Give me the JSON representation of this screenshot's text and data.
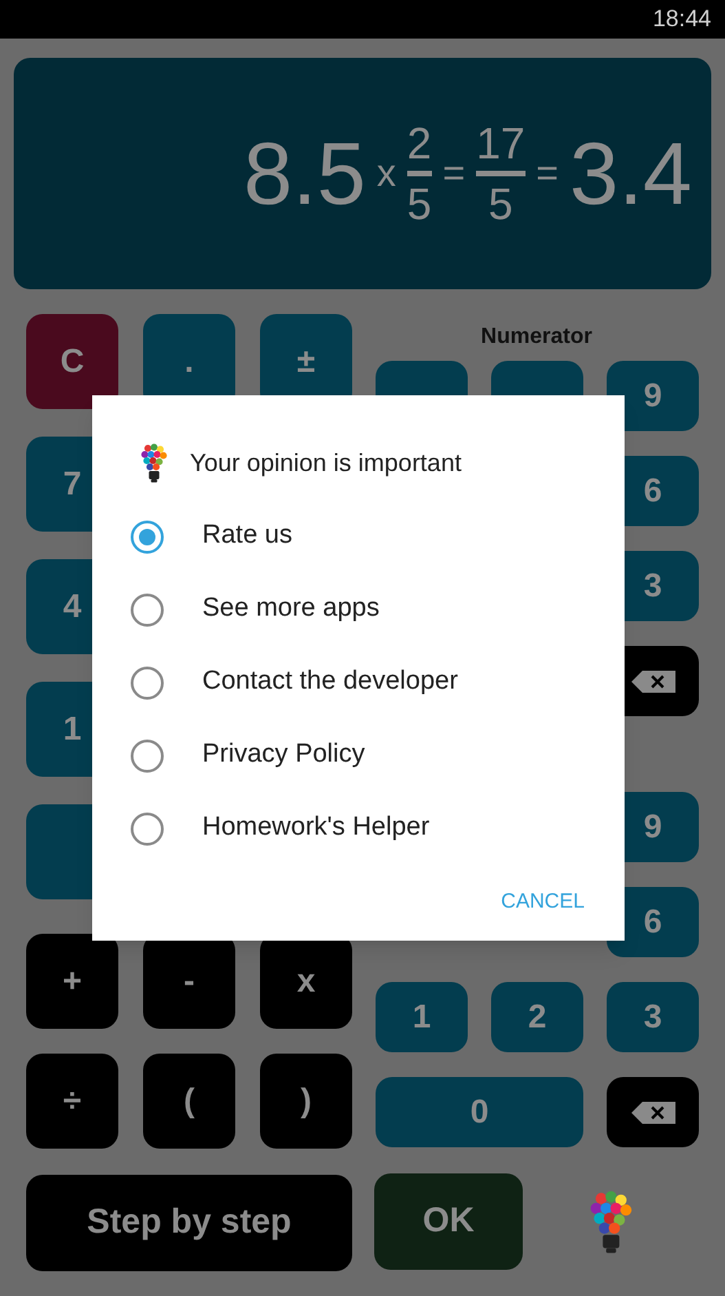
{
  "status_bar": {
    "time": "18:44"
  },
  "display": {
    "expression": [
      {
        "kind": "number",
        "text": "8.5"
      },
      {
        "kind": "operator",
        "text": "x"
      },
      {
        "kind": "fraction",
        "numerator": "2",
        "denominator": "5"
      },
      {
        "kind": "operator",
        "text": "="
      },
      {
        "kind": "fraction",
        "numerator": "17",
        "denominator": "5"
      },
      {
        "kind": "operator",
        "text": "="
      },
      {
        "kind": "number",
        "text": "3.4"
      }
    ]
  },
  "left_keys": [
    [
      {
        "kind": "clear",
        "label": "C"
      },
      {
        "kind": "digit",
        "label": "."
      },
      {
        "kind": "digit",
        "label": "±"
      }
    ],
    [
      {
        "kind": "digit",
        "label": "7"
      }
    ],
    [
      {
        "kind": "digit",
        "label": "4"
      }
    ],
    [
      {
        "kind": "digit",
        "label": "1"
      }
    ],
    [
      {
        "kind": "digit"
      }
    ]
  ],
  "operator_keys": [
    [
      {
        "kind": "operator",
        "label": "+"
      },
      {
        "kind": "operator",
        "label": "-"
      },
      {
        "kind": "operator",
        "label": "x"
      }
    ],
    [
      {
        "kind": "operator",
        "label": "÷"
      },
      {
        "kind": "operator",
        "label": "("
      },
      {
        "kind": "operator",
        "label": ")"
      }
    ]
  ],
  "numerator": {
    "label": "Numerator",
    "rows": [
      [
        {
          "kind": "digit"
        },
        {
          "kind": "digit"
        },
        {
          "kind": "digit",
          "label": "9"
        }
      ],
      [
        {
          "kind": "digit",
          "label": "6"
        }
      ],
      [
        {
          "kind": "digit",
          "label": "3"
        }
      ],
      [
        {
          "kind": "backspace"
        }
      ]
    ]
  },
  "denominator": {
    "rows": [
      [
        {
          "kind": "digit",
          "label": "9"
        }
      ],
      [
        {
          "kind": "digit",
          "label": "6"
        }
      ],
      [
        {
          "kind": "digit",
          "label": "1"
        },
        {
          "kind": "digit",
          "label": "2"
        },
        {
          "kind": "digit",
          "label": "3"
        }
      ],
      [
        {
          "kind": "wide",
          "label": "0"
        },
        {
          "kind": "backspace"
        }
      ]
    ]
  },
  "step_button": "Step by step",
  "ok_button": "OK",
  "dialog": {
    "title": "Your opinion is important",
    "options": [
      {
        "label": "Rate us",
        "selected": true
      },
      {
        "label": "See more apps",
        "selected": false
      },
      {
        "label": "Contact the developer",
        "selected": false
      },
      {
        "label": "Privacy Policy",
        "selected": false
      },
      {
        "label": "Homework's Helper",
        "selected": false
      }
    ],
    "cancel": "CANCEL"
  }
}
